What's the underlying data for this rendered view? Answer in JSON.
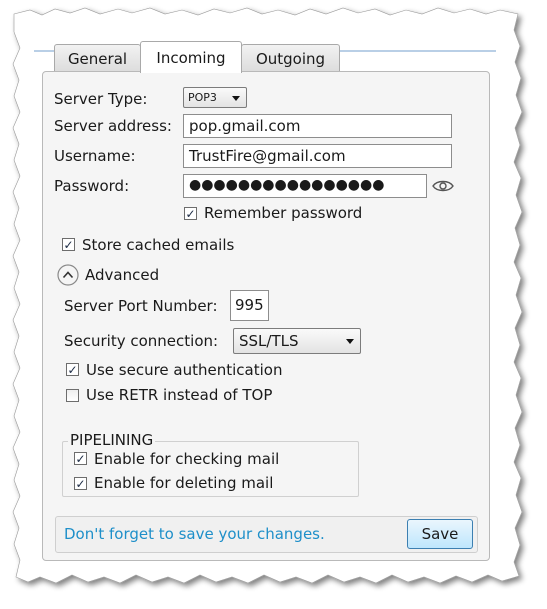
{
  "tabs": [
    {
      "label": "General"
    },
    {
      "label": "Incoming"
    },
    {
      "label": "Outgoing"
    }
  ],
  "active_tab": "Incoming",
  "server_type": {
    "label": "Server Type:",
    "value": "POP3"
  },
  "server_address": {
    "label": "Server address:",
    "value": "pop.gmail.com"
  },
  "username": {
    "label": "Username:",
    "value": "TrustFire@gmail.com"
  },
  "password": {
    "label": "Password:",
    "value": "●●●●●●●●●●●●●●●●",
    "reveal_icon": "eye-icon"
  },
  "remember_password": {
    "label": "Remember password",
    "checked": true
  },
  "store_cached": {
    "label": "Store cached emails",
    "checked": true
  },
  "advanced": {
    "label": "Advanced",
    "icon": "chevron-up-icon"
  },
  "port": {
    "label": "Server Port Number:",
    "value": "995"
  },
  "security": {
    "label": "Security connection:",
    "value": "SSL/TLS"
  },
  "secure_auth": {
    "label": "Use secure authentication",
    "checked": true
  },
  "use_retr": {
    "label": "Use RETR instead of TOP",
    "checked": false
  },
  "pipelining": {
    "title": "PIPELINING",
    "checking": {
      "label": "Enable for checking mail",
      "checked": true
    },
    "deleting": {
      "label": "Enable for deleting mail",
      "checked": true
    }
  },
  "footer": {
    "message": "Don't forget to save your changes.",
    "save_label": "Save"
  },
  "colors": {
    "accent": "#1e8fc9",
    "button_border": "#3c7fb1",
    "tab_line": "#b9cfe6"
  }
}
